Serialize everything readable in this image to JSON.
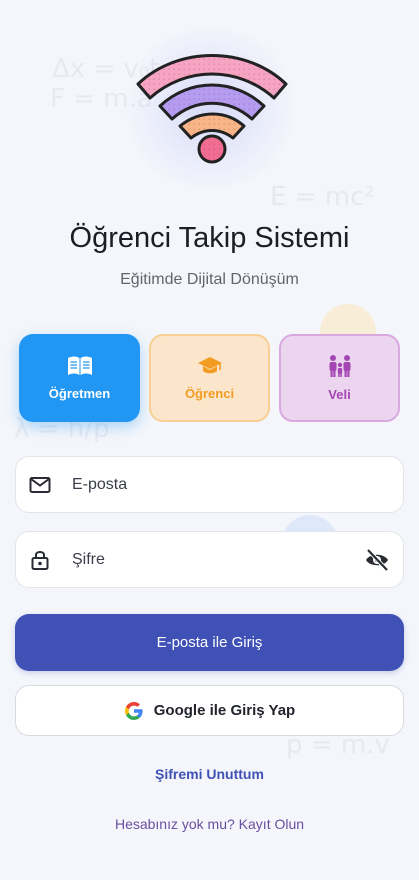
{
  "background": {
    "formulas": [
      "Δx = v₀t",
      "F = m.a",
      "E = mc²",
      "λ = h/p",
      "p = m.v"
    ]
  },
  "header": {
    "title": "Öğrenci Takip Sistemi",
    "subtitle": "Eğitimde Dijital Dönüşüm",
    "logo_icon": "wifi-icon"
  },
  "roles": [
    {
      "label": "Öğretmen",
      "icon": "book-icon",
      "selected": true,
      "color": "#2196f3"
    },
    {
      "label": "Öğrenci",
      "icon": "graduation-cap-icon",
      "selected": false,
      "color": "#f39c24"
    },
    {
      "label": "Veli",
      "icon": "family-icon",
      "selected": false,
      "color": "#a446b3"
    }
  ],
  "form": {
    "email": {
      "placeholder": "E-posta",
      "value": "",
      "icon": "mail-icon"
    },
    "password": {
      "placeholder": "Şifre",
      "value": "",
      "icon": "lock-icon",
      "toggle_icon": "visibility-off-icon"
    }
  },
  "actions": {
    "email_login_label": "E-posta ile Giriş",
    "google_login_label": "Google ile Giriş Yap",
    "forgot_password_label": "Şifremi Unuttum",
    "register_label": "Hesabınız yok mu? Kayıt Olun"
  },
  "colors": {
    "primary": "#3f51b5",
    "teacher": "#2196f3",
    "student": "#f39c24",
    "parent": "#a446b3"
  }
}
